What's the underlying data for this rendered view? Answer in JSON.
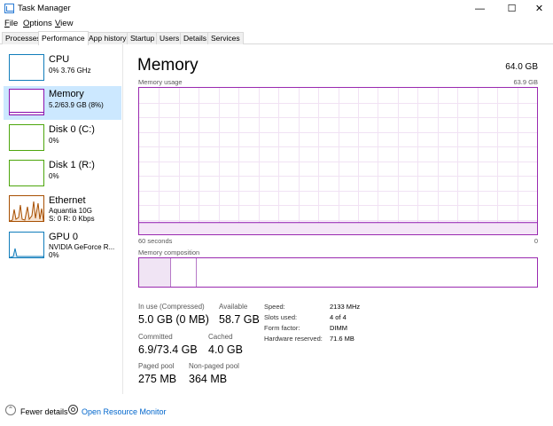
{
  "window": {
    "title": "Task Manager",
    "minimize": "—",
    "maximize": "☐",
    "close": "✕"
  },
  "menu": [
    {
      "label": "File",
      "key": "F",
      "rest": "ile"
    },
    {
      "label": "Options",
      "key": "O",
      "rest": "ptions"
    },
    {
      "label": "View",
      "key": "V",
      "rest": "iew"
    }
  ],
  "tabs": [
    "Processes",
    "Performance",
    "App history",
    "Startup",
    "Users",
    "Details",
    "Services"
  ],
  "active_tab": "Performance",
  "sidebar": [
    {
      "name": "CPU",
      "sub": "0% 3.76 GHz",
      "color": "#117dbb"
    },
    {
      "name": "Memory",
      "sub": "5.2/63.9 GB (8%)",
      "color": "#8b12ae",
      "selected": true
    },
    {
      "name": "Disk 0 (C:)",
      "sub": "0%",
      "color": "#4da60c"
    },
    {
      "name": "Disk 1 (R:)",
      "sub": "0%",
      "color": "#4da60c"
    },
    {
      "name": "Ethernet",
      "sub": "Aquantia 10G",
      "sub2": "S: 0 R: 0 Kbps",
      "color": "#a74f01"
    },
    {
      "name": "GPU 0",
      "sub": "NVIDIA GeForce R...",
      "sub2": "0%",
      "color": "#117dbb"
    }
  ],
  "main": {
    "title": "Memory",
    "total": "64.0 GB",
    "usage_label": "Memory usage",
    "usage_max": "63.9 GB",
    "time_left": "60 seconds",
    "time_right": "0",
    "composition_label": "Memory composition",
    "usage_fraction": 0.08,
    "stats": {
      "in_use_label": "In use (Compressed)",
      "in_use": "5.0 GB (0 MB)",
      "available_label": "Available",
      "available": "58.7 GB",
      "committed_label": "Committed",
      "committed": "6.9/73.4 GB",
      "cached_label": "Cached",
      "cached": "4.0 GB",
      "paged_label": "Paged pool",
      "paged": "275 MB",
      "nonpaged_label": "Non-paged pool",
      "nonpaged": "364 MB"
    },
    "details": [
      {
        "label": "Speed:",
        "value": "2133 MHz"
      },
      {
        "label": "Slots used:",
        "value": "4 of 4"
      },
      {
        "label": "Form factor:",
        "value": "DIMM"
      },
      {
        "label": "Hardware reserved:",
        "value": "71.6 MB"
      }
    ]
  },
  "footer": {
    "fewer_details": "Fewer details",
    "open_resource_monitor": "Open Resource Monitor"
  }
}
